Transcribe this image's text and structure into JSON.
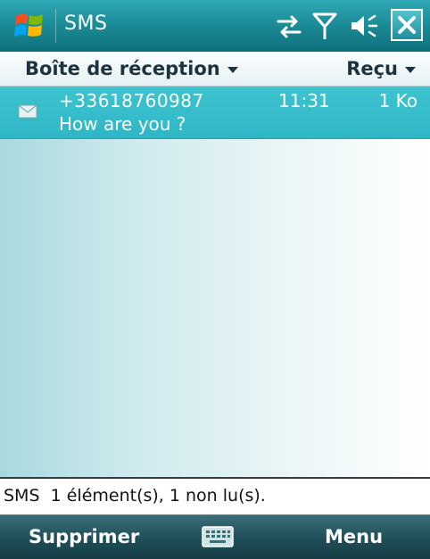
{
  "titlebar": {
    "app_title": "SMS",
    "icons": [
      "windows-logo-icon",
      "connectivity-icon",
      "signal-icon",
      "speaker-icon",
      "close-icon"
    ],
    "accent_color": "#1c8d99"
  },
  "header": {
    "folder_label": "Boîte de réception",
    "sort_label": "Reçu"
  },
  "messages": [
    {
      "from": "+33618760987",
      "time": "11:31",
      "size": "1 Ko",
      "body": "How are you ?",
      "icon": "envelope-icon",
      "selected": true
    }
  ],
  "status": {
    "text": "SMS  1 élément(s), 1 non lu(s)."
  },
  "softkeys": {
    "left": "Supprimer",
    "right": "Menu",
    "center_icon": "keyboard-icon"
  }
}
